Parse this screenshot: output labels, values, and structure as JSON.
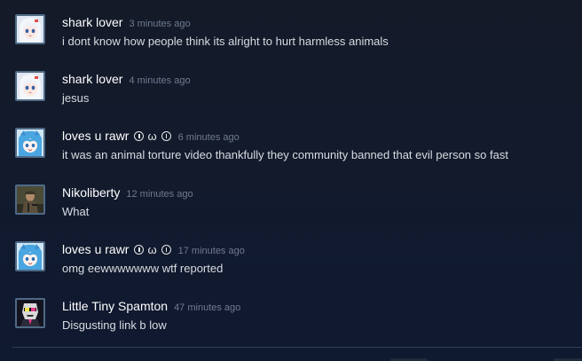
{
  "comments": [
    {
      "author": "shark lover",
      "timestamp": "3 minutes ago",
      "text": "i dont know how people think its alright to hurt harmless animals",
      "avatar": "white-haired-anime-girl-avatar"
    },
    {
      "author": "shark lover",
      "timestamp": "4 minutes ago",
      "text": "jesus",
      "avatar": "white-haired-anime-girl-avatar"
    },
    {
      "author": "loves u rawr",
      "badge_middle": "ω",
      "timestamp": "6 minutes ago",
      "text": "it was an animal torture video thankfully they community banned that evil person so fast",
      "avatar": "blue-haired-anime-avatar"
    },
    {
      "author": "Nikoliberty",
      "timestamp": "12 minutes ago",
      "text": "What",
      "avatar": "soldier-avatar"
    },
    {
      "author": "loves u rawr",
      "badge_middle": "ω",
      "timestamp": "17 minutes ago",
      "text": "omg eewwwwwww wtf reported",
      "avatar": "blue-haired-anime-avatar"
    },
    {
      "author": "Little Tiny Spamton",
      "timestamp": "47 minutes ago",
      "text": "Disgusting link b low",
      "avatar": "spamton-avatar"
    }
  ],
  "colors": {
    "background": "#121a2c",
    "author": "#ffffff",
    "timestamp": "#6f7b8f",
    "comment_text": "#d8dbe0",
    "avatar_border": "#4f6a86"
  }
}
